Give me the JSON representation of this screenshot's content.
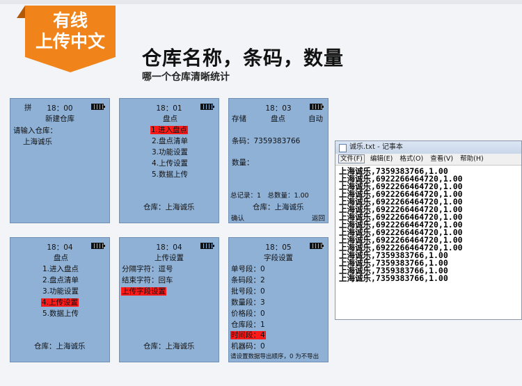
{
  "badge": {
    "line1": "有线",
    "line2": "上传中文"
  },
  "headline": "仓库名称，条码，数量",
  "subheadline": "哪一个仓库清晰统计",
  "screens": {
    "s1": {
      "prefix": "拼",
      "time": "18：00",
      "title": "新建仓库",
      "prompt": "请输入仓库：",
      "value": "上海诚乐"
    },
    "s2": {
      "time": "18：01",
      "title": "盘点",
      "items": [
        "1.进入盘点",
        "2.盘点清单",
        "3.功能设置",
        "4.上传设置",
        "5.数据上传"
      ],
      "footer": "仓库：上海诚乐"
    },
    "s3": {
      "time": "18：03",
      "left": "存储",
      "title": "盘点",
      "right": "自动",
      "barcode": "条码：7359383766",
      "qty": "数量：",
      "totals": "总记录：1　总数量：1.00",
      "warehouse": "仓库：上海诚乐",
      "confirm": "确认",
      "back": "返回"
    },
    "s4": {
      "time": "18：04",
      "title": "盘点",
      "items": [
        "1.进入盘点",
        "2.盘点清单",
        "3.功能设置",
        "4.上传设置",
        "5.数据上传"
      ],
      "footer": "仓库：上海诚乐"
    },
    "s5": {
      "time": "18：04",
      "title": "上传设置",
      "items": [
        "分隔字符：逗号",
        "结束字符：回车",
        "上传字段设置"
      ],
      "footer": "仓库：上海诚乐"
    },
    "s6": {
      "time": "18：05",
      "title": "字段设置",
      "items": [
        "单号段：0",
        "条码段：2",
        "批号段：0",
        "数量段：3",
        "价格段：0",
        "仓库段：1",
        "时间段：4",
        "机器码：0"
      ],
      "hint": "请设置数据导出顺序，0 为不导出"
    }
  },
  "notepad": {
    "title": "诚乐.txt - 记事本",
    "menu": [
      "文件(F)",
      "编辑(E)",
      "格式(O)",
      "查看(V)",
      "帮助(H)"
    ],
    "lines": [
      "上海诚乐,7359383766,1.00",
      "上海诚乐,6922266464720,1.00",
      "上海诚乐,6922266464720,1.00",
      "上海诚乐,6922266464720,1.00",
      "上海诚乐,6922266464720,1.00",
      "上海诚乐,6922266464720,1.00",
      "上海诚乐,6922266464720,1.00",
      "上海诚乐,6922266464720,1.00",
      "上海诚乐,6922266464720,1.00",
      "上海诚乐,6922266464720,1.00",
      "上海诚乐,6922266464720,1.00",
      "上海诚乐,7359383766,1.00",
      "上海诚乐,7359383766,1.00",
      "上海诚乐,7359383766,1.00",
      "上海诚乐,7359383766,1.00"
    ]
  },
  "colors": {
    "badge": "#f08319",
    "screen": "#8fb1d6",
    "highlight": "#ff1a1a"
  }
}
